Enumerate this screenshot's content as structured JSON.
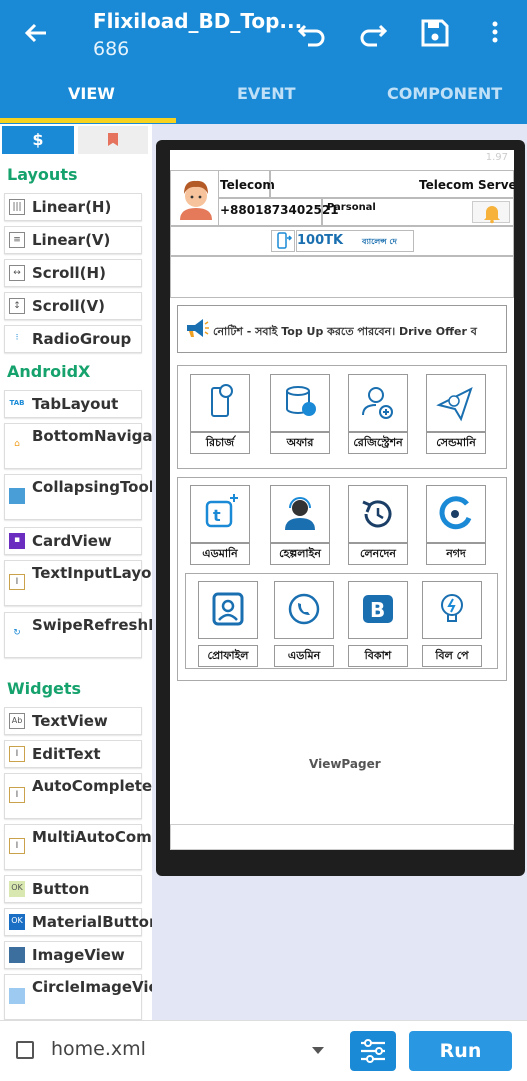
{
  "appbar": {
    "title": "Flixiload_BD_Top...",
    "subtitle": "686",
    "tabs": [
      "VIEW",
      "EVENT",
      "COMPONENT"
    ]
  },
  "palette": {
    "tab1_icon": "$",
    "sections": {
      "layouts": "Layouts",
      "androidx": "AndroidX",
      "widgets": "Widgets"
    },
    "items": [
      "Linear(H)",
      "Linear(V)",
      "Scroll(H)",
      "Scroll(V)",
      "RadioGroup",
      "TabLayout",
      "BottomNavigationView",
      "CollapsingToolbar",
      "CardView",
      "TextInputLayout",
      "SwipeRefreshLayout",
      "TextView",
      "EditText",
      "AutoCompleteTextView",
      "MultiAutoCompleteTextView",
      "Button",
      "MaterialButton",
      "ImageView",
      "CircleImageView"
    ]
  },
  "screen": {
    "corner_num": "1.97",
    "header": {
      "telecom": "Telecom",
      "server": "Telecom Server",
      "phone": "+8801873402521",
      "type": "Parsonal"
    },
    "balance": "100TK",
    "balance_suffix": "ব্যালেন্স দে",
    "notice": "নোটিশ - সবাই Top Up করতে পারবেন। Drive Offer ব",
    "grid1": [
      "রিচার্জ",
      "অফার",
      "রেজিস্ট্রেশন",
      "সেন্ডমানি"
    ],
    "grid2": [
      "এডমানি",
      "হেল্পলাইন",
      "লেনদেন",
      "নগদ"
    ],
    "grid3": [
      "প্রোফাইল",
      "এডমিন",
      "বিকাশ",
      "বিল পে"
    ],
    "viewpager": "ViewPager"
  },
  "bottom": {
    "file": "home.xml",
    "run": "Run"
  },
  "colors": {
    "primary": "#1a8ad6",
    "accent": "#f7d21f",
    "section": "#16a26d"
  }
}
